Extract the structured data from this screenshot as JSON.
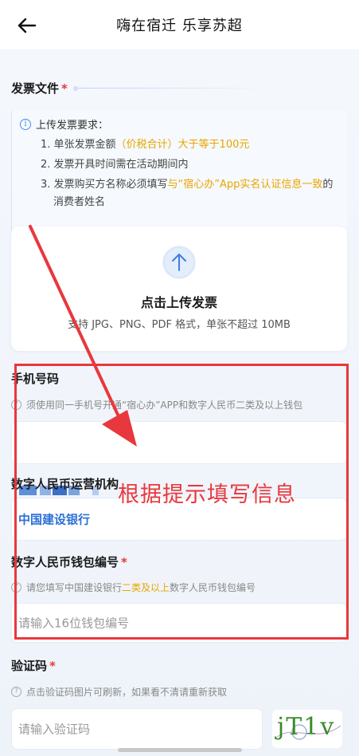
{
  "header": {
    "title": "嗨在宿迁 乐享苏超",
    "back_icon": "arrow-left-icon"
  },
  "invoice": {
    "section_label": "发票文件",
    "required_mark": "*",
    "notice_title": "上传发票要求：",
    "items": [
      {
        "prefix": "1. 单张发票金额",
        "highlight": "（价税合计）大于等于100元",
        "suffix": ""
      },
      {
        "prefix": "2. 发票开具时间需在活动期间内",
        "highlight": "",
        "suffix": ""
      },
      {
        "prefix": "3. 发票购买方名称必须填写",
        "highlight": "与“宿心办”App实名认证信息一致",
        "suffix": "的"
      },
      {
        "prefix": "消费者姓名",
        "highlight": "",
        "suffix": ""
      }
    ],
    "upload_title": "点击上传发票",
    "upload_hint": "支持 JPG、PNG、PDF 格式，单张不超过 10MB"
  },
  "phone": {
    "label": "手机号码",
    "hint": "须使用同一手机号开通“宿心办”APP和数字人民币二类及以上钱包"
  },
  "operator": {
    "label": "数字人民币运营机构",
    "value": "中国建设银行"
  },
  "wallet": {
    "label": "数字人民币钱包编号",
    "required_mark": "*",
    "hint_prefix": "请您填写中国建设银行",
    "hint_highlight": "二类及以上",
    "hint_suffix": "数字人民币钱包编号",
    "placeholder": "请输入16位钱包编号"
  },
  "captcha": {
    "label": "验证码",
    "required_mark": "*",
    "hint": "点击验证码图片可刷新，如果看不清请重新获取",
    "placeholder": "请输入验证码",
    "image_text": "jT1v"
  },
  "annotation": {
    "text": "根据提示填写信息",
    "color": "#e8383d"
  },
  "colors": {
    "accent": "#2c6fd6",
    "highlight": "#e8a500",
    "required": "#e53935"
  }
}
